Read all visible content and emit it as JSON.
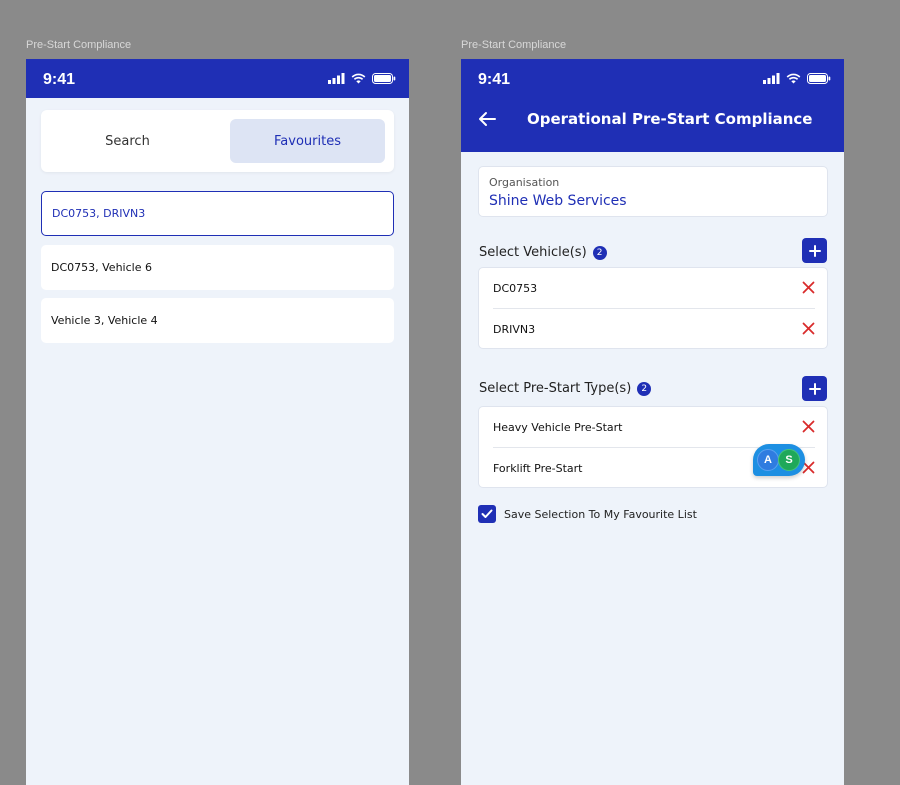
{
  "frames": {
    "left_label": "Pre-Start Compliance",
    "right_label": "Pre-Start Compliance"
  },
  "status_bar": {
    "time": "9:41"
  },
  "left": {
    "segmented": {
      "search_label": "Search",
      "favourites_label": "Favourites",
      "active": "Favourites"
    },
    "favourites": [
      {
        "label": "DC0753, DRIVN3",
        "selected": true
      },
      {
        "label": "DC0753, Vehicle 6",
        "selected": false
      },
      {
        "label": "Vehicle 3, Vehicle 4",
        "selected": false
      }
    ]
  },
  "right": {
    "title": "Operational Pre-Start Compliance",
    "organisation": {
      "label": "Organisation",
      "value": "Shine Web Services"
    },
    "vehicles": {
      "title": "Select Vehicle(s)",
      "count": "2",
      "items": [
        "DC0753",
        "DRIVN3"
      ]
    },
    "prestart_types": {
      "title": "Select Pre-Start Type(s)",
      "count": "2",
      "items": [
        "Heavy Vehicle Pre-Start",
        "Forklift Pre-Start"
      ]
    },
    "avatars": [
      "A",
      "S"
    ],
    "save_favourite": {
      "label": "Save Selection To My Favourite List",
      "checked": true
    }
  },
  "colors": {
    "primary": "#1f2fb5",
    "background": "#eef3fa",
    "remove": "#d92b2b",
    "canvas": "#8a8a8a"
  },
  "icons": [
    "signal-icon",
    "wifi-icon",
    "battery-icon",
    "back-arrow-icon",
    "plus-icon",
    "close-icon",
    "check-icon"
  ]
}
